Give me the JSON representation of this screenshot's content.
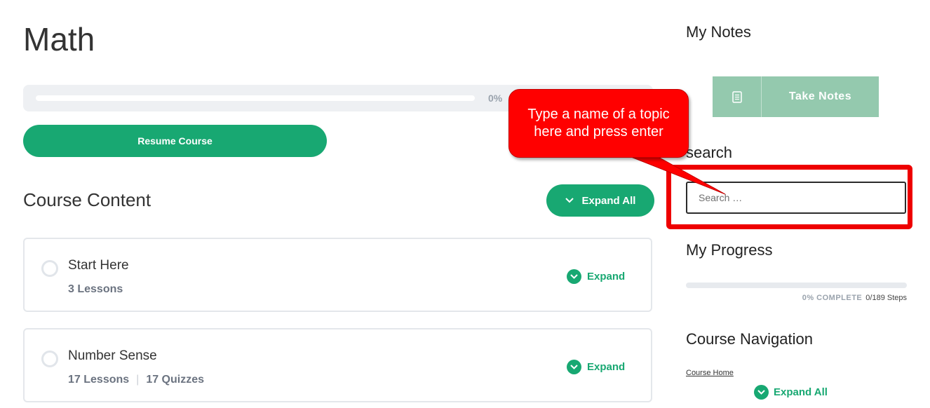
{
  "course": {
    "title": "Math",
    "progress_percent": 0,
    "progress_label": "0%",
    "resume_label": "Resume Course"
  },
  "content": {
    "heading": "Course Content",
    "expand_all_label": "Expand All",
    "sections": [
      {
        "title": "Start Here",
        "lessons": "3 Lessons",
        "quizzes": "",
        "expand_label": "Expand"
      },
      {
        "title": "Number Sense",
        "lessons": "17 Lessons",
        "quizzes": "17 Quizzes",
        "expand_label": "Expand"
      }
    ]
  },
  "sidebar": {
    "notes_heading": "My Notes",
    "take_notes_label": "Take Notes",
    "search_heading": "search",
    "search_placeholder": "Search …",
    "search_value": "",
    "progress_heading": "My Progress",
    "progress_percent": 0,
    "complete_label": "0% COMPLETE",
    "steps_label": "0/189 Steps",
    "nav_heading": "Course Navigation",
    "course_home_label": "Course Home",
    "expand_all_label": "Expand All"
  },
  "annotation": {
    "callout_text": "Type a name of a topic here and press enter"
  },
  "colors": {
    "accent": "#18a872",
    "notes_button": "#94c9ae",
    "annotation_red": "#ff0000"
  },
  "icons": {
    "chevron": "chevron-down-icon",
    "check": "check-circle-icon",
    "notes": "notes-icon"
  }
}
